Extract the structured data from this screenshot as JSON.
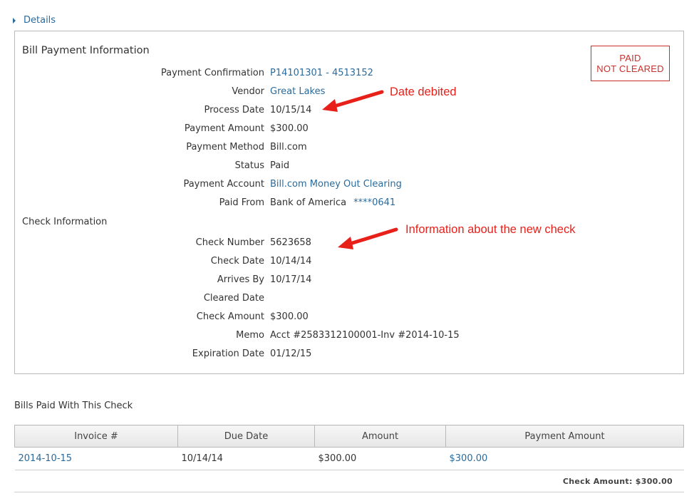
{
  "details_label": "Details",
  "bill_payment": {
    "title": "Bill Payment Information",
    "rows": [
      {
        "label": "Payment Confirmation",
        "value": "P14101301 - 4513152"
      },
      {
        "label": "Vendor",
        "value": "Great Lakes"
      },
      {
        "label": "Process Date",
        "value": "10/15/14"
      },
      {
        "label": "Payment Amount",
        "value": "$300.00"
      },
      {
        "label": "Payment Method",
        "value": "Bill.com"
      },
      {
        "label": "Status",
        "value": "Paid"
      },
      {
        "label": "Payment Account",
        "value": "Bill.com Money Out Clearing"
      },
      {
        "label": "Paid From",
        "value": "Bank of America",
        "masked_account": "****0641"
      }
    ]
  },
  "status_stamp": {
    "line1": "PAID",
    "line2": "NOT CLEARED",
    "color": "#c9302c"
  },
  "check_info": {
    "title": "Check Information",
    "rows": [
      {
        "label": "Check Number",
        "value": "5623658"
      },
      {
        "label": "Check Date",
        "value": "10/14/14"
      },
      {
        "label": "Arrives By",
        "value": "10/17/14"
      },
      {
        "label": "Cleared Date",
        "value": ""
      },
      {
        "label": "Check Amount",
        "value": "$300.00"
      },
      {
        "label": "Memo",
        "value": "Acct #2583312100001-Inv #2014-10-15"
      },
      {
        "label": "Expiration Date",
        "value": "01/12/15"
      }
    ]
  },
  "annotations": {
    "date_debited": "Date debited",
    "new_check_info": "Information about the new check",
    "color": "#e8201a"
  },
  "bills_paid": {
    "title": "Bills Paid With This Check",
    "headers": [
      "Invoice #",
      "Due Date",
      "Amount",
      "Payment Amount"
    ],
    "rows": [
      {
        "invoice": "2014-10-15",
        "due_date": "10/14/14",
        "amount": "$300.00",
        "payment_amount": "$300.00"
      }
    ],
    "check_amount_text": "Check Amount: $300.00"
  },
  "colors": {
    "link": "#2a6b9c",
    "border": "#b9b9b9"
  }
}
